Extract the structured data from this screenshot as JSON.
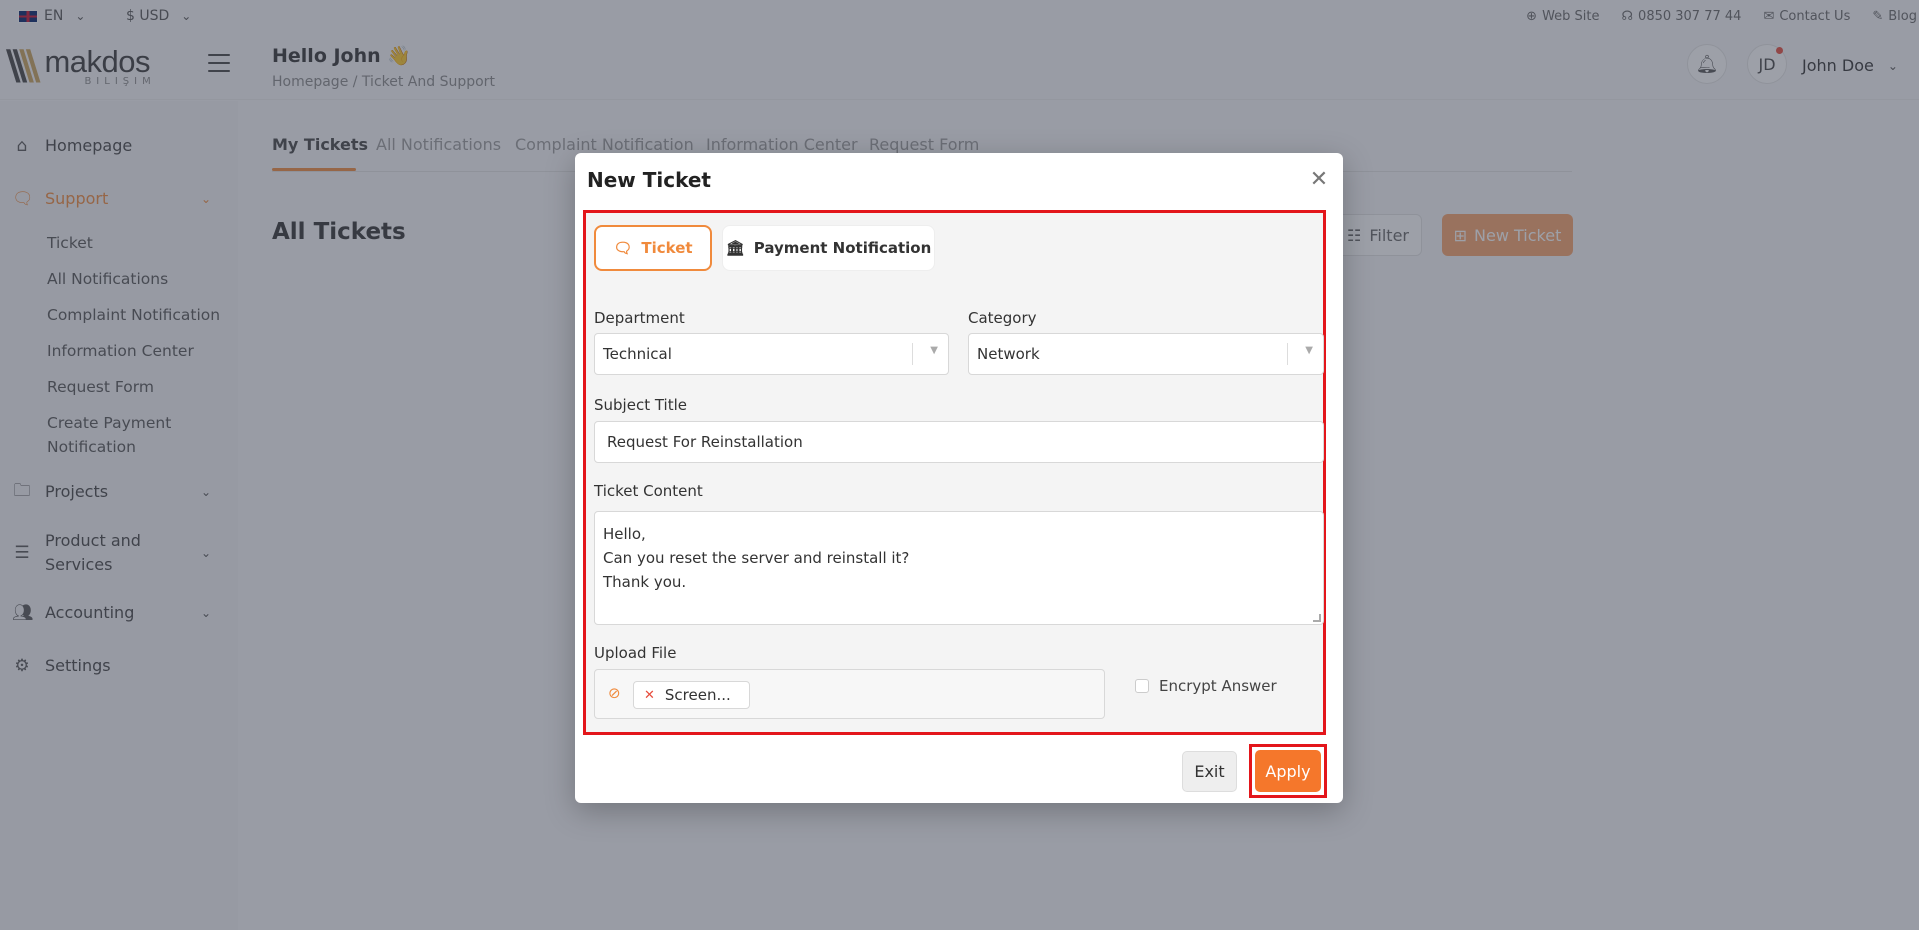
{
  "topbar": {
    "language": "EN",
    "currency": "$ USD",
    "links": {
      "website": "Web Site",
      "phone": "0850 307 77 44",
      "contact": "Contact Us",
      "blog": "Blog"
    }
  },
  "header": {
    "logo_word": "makdos",
    "logo_sub": "BILIŞIM",
    "greeting": "Hello John 👋",
    "breadcrumb": "Homepage / Ticket And Support",
    "avatar_initials": "JD",
    "user_name": "John Doe"
  },
  "sidebar": {
    "items": [
      {
        "label": "Homepage",
        "icon": "home-icon"
      },
      {
        "label": "Support",
        "icon": "chat-icon",
        "active": true
      },
      {
        "label": "Projects",
        "icon": "folder-icon"
      },
      {
        "label": "Product and\nServices",
        "icon": "list-icon"
      },
      {
        "label": "Accounting",
        "icon": "users-icon"
      },
      {
        "label": "Settings",
        "icon": "gear-icon"
      }
    ],
    "support_sub": [
      "Ticket",
      "All Notifications",
      "Complaint Notification",
      "Information Center",
      "Request Form",
      "Create Payment\nNotification"
    ],
    "product_label_1": "Product and",
    "product_label_2": "Services",
    "payment_label_1": "Create Payment",
    "payment_label_2": "Notification"
  },
  "main": {
    "tabs": [
      "My Tickets",
      "All Notifications",
      "Complaint Notification",
      "Information Center",
      "Request Form"
    ],
    "title": "All Tickets",
    "filter_label": "Filter",
    "new_ticket_label": "New Ticket"
  },
  "modal": {
    "title": "New Ticket",
    "type_tabs": {
      "ticket": "Ticket",
      "payment": "Payment Notification"
    },
    "department": {
      "label": "Department",
      "value": "Technical"
    },
    "category": {
      "label": "Category",
      "value": "Network"
    },
    "subject": {
      "label": "Subject Title",
      "value": "Request For Reinstallation"
    },
    "content": {
      "label": "Ticket Content",
      "lines": [
        "Hello,",
        "Can you reset the server and reinstall it?",
        "Thank you."
      ]
    },
    "upload": {
      "label": "Upload File",
      "file_chip": "Screen..."
    },
    "encrypt_label": "Encrypt Answer",
    "exit_label": "Exit",
    "apply_label": "Apply"
  },
  "colors": {
    "accent": "#f08a3c",
    "apply": "#f5772b",
    "highlight": "#e3161b"
  }
}
